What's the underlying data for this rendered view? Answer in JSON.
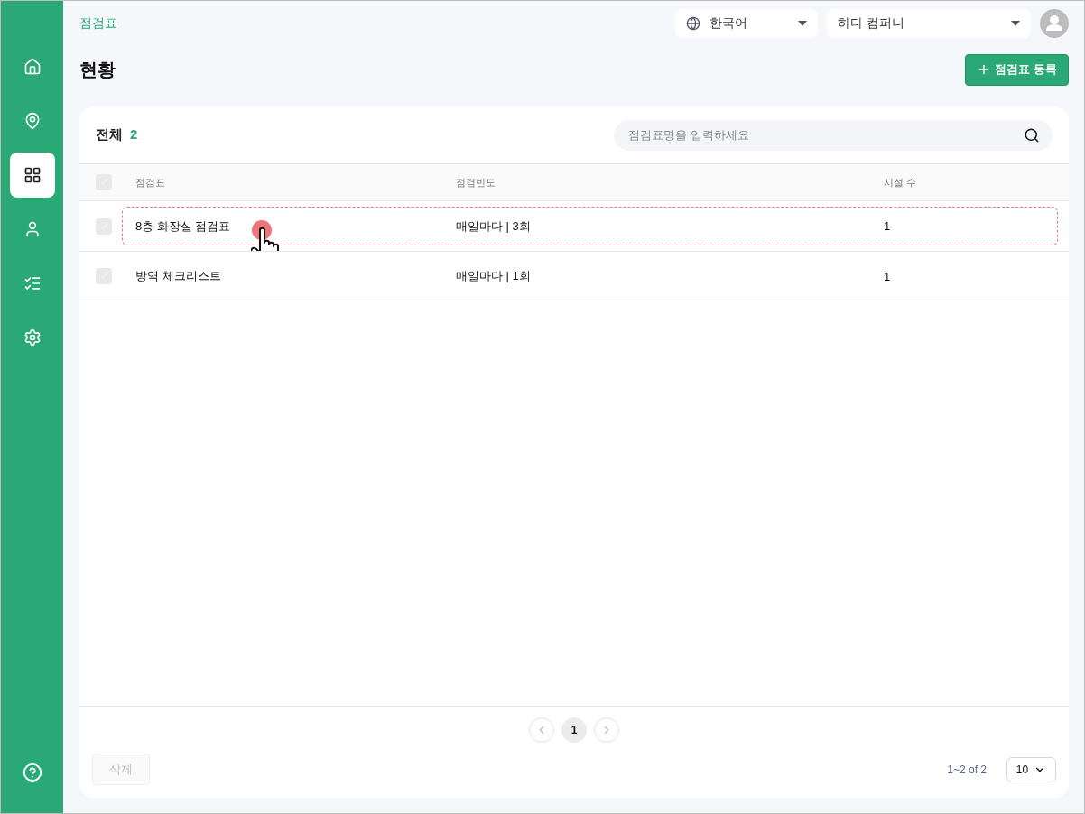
{
  "sidebar": {
    "items": [
      {
        "selected": false
      },
      {
        "selected": false
      },
      {
        "selected": true
      },
      {
        "selected": false
      },
      {
        "selected": false
      },
      {
        "selected": false
      }
    ]
  },
  "header": {
    "breadcrumb": "점검표",
    "language": "한국어",
    "company": "하다 컴퍼니"
  },
  "page_title": "현황",
  "add_button": "점검표 등록",
  "card": {
    "total_label": "전체",
    "total_count": "2",
    "search": {
      "placeholder": "점검표명을 입력하세요"
    }
  },
  "table": {
    "all_checked": false,
    "columns": [
      "점검표",
      "점검빈도",
      "시설 수"
    ],
    "rows": [
      {
        "cells": [
          "8층 화장실 점검표",
          "매일마다 | 3회",
          "1"
        ],
        "checked": false,
        "highlighted": true
      },
      {
        "cells": [
          "방역 체크리스트",
          "매일마다 | 1회",
          "1"
        ],
        "checked": false,
        "highlighted": false
      }
    ]
  },
  "pagination": {
    "pages": [
      {
        "label": "1",
        "selected": true
      }
    ]
  },
  "footer": {
    "delete_button": "삭제",
    "delete_disabled": true,
    "range": "1~2 of 2",
    "page_size": "10"
  }
}
